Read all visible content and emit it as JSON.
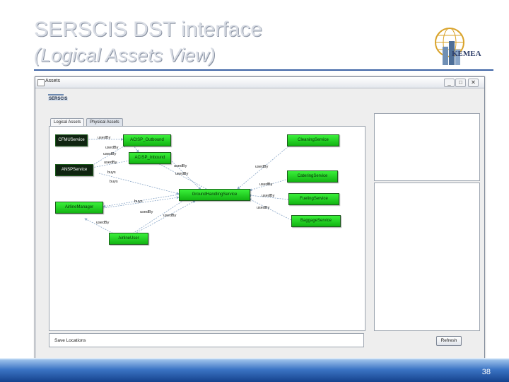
{
  "slide": {
    "title_line1": "SERSCIS DST interface",
    "title_line2": "(Logical Assets View)",
    "page_number": "38",
    "logo_text": "KEMEA"
  },
  "window": {
    "title": "Assets",
    "minimize_label": "_",
    "maximize_label": "□",
    "close_label": "✕",
    "app_logo_text": "SERSCIS"
  },
  "tabs": [
    {
      "label": "Logical Assets",
      "selected": true
    },
    {
      "label": "Physical Assets",
      "selected": false
    }
  ],
  "graph": {
    "nodes": {
      "cfmu": "CFMUService",
      "acisp_out": "ACISP_Outbound",
      "acisp_in": "ACISP_Inbound",
      "ansp": "ANSPService",
      "airline_mgr": "AirlineManager",
      "ground": "GroundHandlingService",
      "airline_user": "AirlineUser",
      "cleaning": "CleaningService",
      "catering": "CateringService",
      "fueling": "FuelingService",
      "baggage": "BaggageService"
    },
    "edge_labels": {
      "e1": "usedBy",
      "e2": "usedBy",
      "e3": "usedBy",
      "e4": "usedBy",
      "e5": "usedBy",
      "e6": "buys",
      "e7": "buys",
      "e8": "usedBy",
      "e9": "usedBy",
      "e10": "usedBy",
      "e11": "usedBy",
      "e12": "buys",
      "e13": "usedBy",
      "e14": "usedBy",
      "e15": "usedBy",
      "e16": "usedBy"
    }
  },
  "footer": {
    "save_locations": "Save Locations",
    "refresh_button": "Refresh"
  },
  "colors": {
    "node_green": "#22d022",
    "node_dark": "#0f2410",
    "title_rule": "#3d63a5"
  }
}
